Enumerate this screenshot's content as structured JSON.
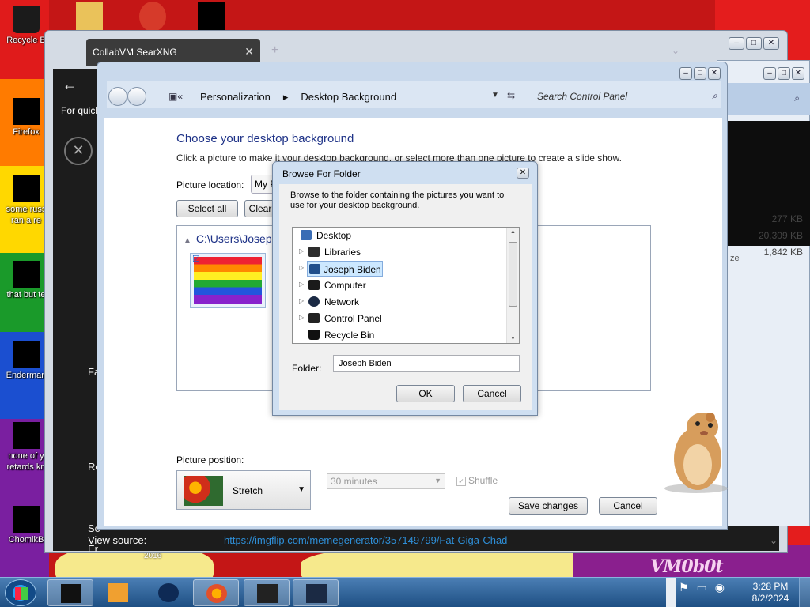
{
  "desktop": {
    "icons": [
      {
        "label": "Recycle B"
      },
      {
        "label": "Firefox"
      },
      {
        "label": "some russ ran a re"
      },
      {
        "label": "that but te"
      },
      {
        "label": "Enderman"
      },
      {
        "label": "none of y retards kn"
      },
      {
        "label": "ChomikB"
      }
    ],
    "wallpaper_watermark": "VM0b0t",
    "wallpaper_small_text": "2016"
  },
  "browser": {
    "tab_title": "CollabVM SearXNG",
    "tab_close": "✕",
    "new_tab": "+",
    "for_quick_text": "For quick",
    "side_letters": [
      "Fa",
      "Re",
      "So",
      "Er"
    ],
    "view_source_label": "View source:",
    "view_source_url": "https://imgflip.com/memegenerator/357149799/Fat-Giga-Chad"
  },
  "explorer_right": {
    "column_header": "ze",
    "sizes": [
      "277 KB",
      "20,309 KB",
      "1,842 KB"
    ]
  },
  "control_panel": {
    "breadcrumb": [
      "Personalization",
      "Desktop Background"
    ],
    "search_placeholder": "Search Control Panel",
    "heading": "Choose your desktop background",
    "description": "Click a picture to make it your desktop background, or select more than one picture to create a slide show.",
    "picture_location_label": "Picture location:",
    "picture_location_value": "My P",
    "select_all": "Select all",
    "clear_all": "Clear all",
    "folder_path": "C:\\Users\\Joseph",
    "picture_position_label": "Picture position:",
    "picture_position_value": "Stretch",
    "interval_value": "30 minutes",
    "shuffle_label": "Shuffle",
    "save_changes": "Save changes",
    "cancel": "Cancel"
  },
  "browse_dialog": {
    "title": "Browse For Folder",
    "message": "Browse to the folder containing the pictures you want to use for your desktop background.",
    "tree": [
      {
        "name": "Desktop",
        "expandable": false,
        "icon_color": "#3a6db5",
        "selected": false
      },
      {
        "name": "Libraries",
        "expandable": true,
        "icon_color": "#2d2d2d",
        "selected": false
      },
      {
        "name": "Joseph Biden",
        "expandable": true,
        "icon_color": "#1f4e8c",
        "selected": true
      },
      {
        "name": "Computer",
        "expandable": true,
        "icon_color": "#1a1a1a",
        "selected": false
      },
      {
        "name": "Network",
        "expandable": true,
        "icon_color": "#1b2a44",
        "selected": false
      },
      {
        "name": "Control Panel",
        "expandable": true,
        "icon_color": "#222",
        "selected": false
      },
      {
        "name": "Recycle Bin",
        "expandable": false,
        "icon_color": "#111",
        "selected": false
      }
    ],
    "folder_label": "Folder:",
    "folder_value": "Joseph Biden",
    "ok": "OK",
    "cancel": "Cancel"
  },
  "taskbar": {
    "time": "3:28 PM",
    "date": "8/2/2024"
  }
}
